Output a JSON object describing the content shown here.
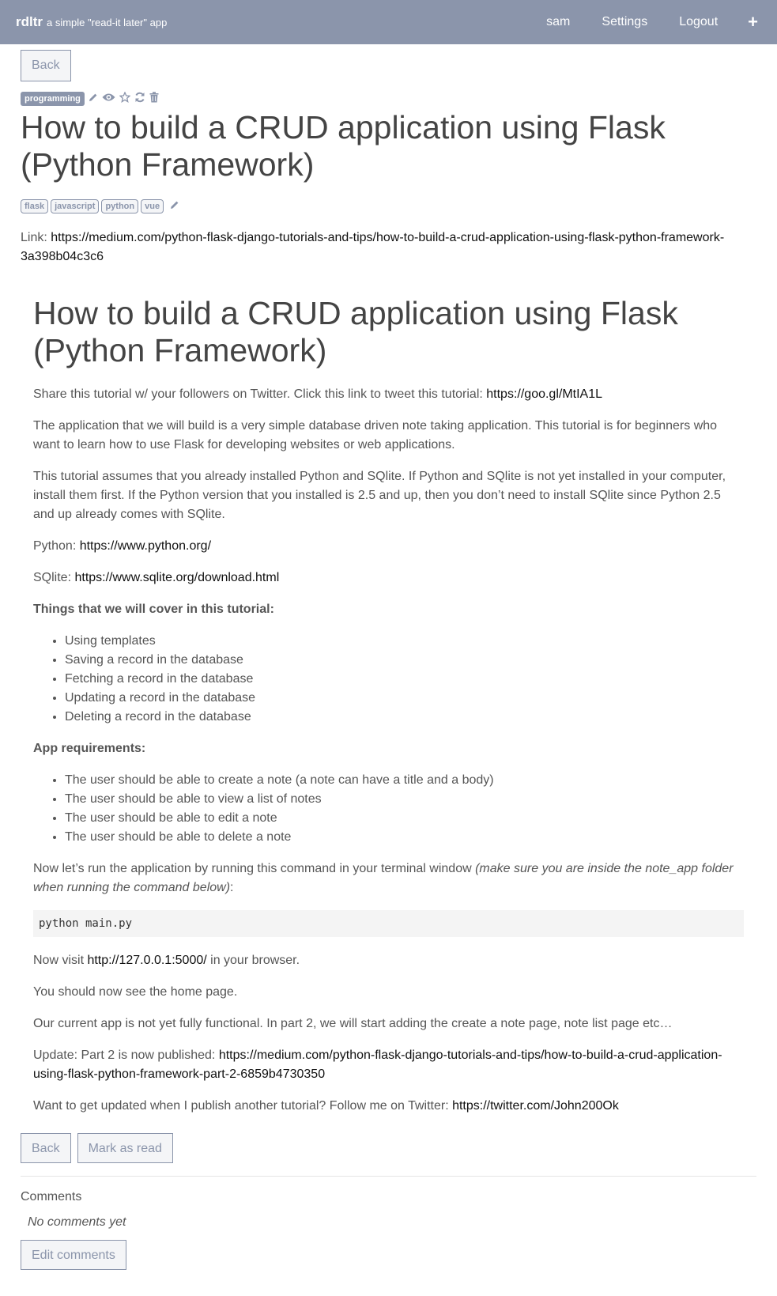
{
  "navbar": {
    "brand": "rdltr",
    "tagline": "a simple \"read-it later\" app",
    "user": "sam",
    "settings": "Settings",
    "logout": "Logout",
    "add": "+"
  },
  "article_meta": {
    "back_label": "Back",
    "category": "programming",
    "title": "How to build a CRUD application using Flask (Python Framework)",
    "tags": [
      "flask",
      "javascript",
      "python",
      "vue"
    ],
    "link_label": "Link:",
    "link_url": "https://medium.com/python-flask-django-tutorials-and-tips/how-to-build-a-crud-application-using-flask-python-framework-3a398b04c3c6"
  },
  "content": {
    "heading": "How to build a CRUD application using Flask (Python Framework)",
    "p1_text": "Share this tutorial w/ your followers on Twitter. Click this link to tweet this tutorial: ",
    "p1_link": "https://goo.gl/MtIA1L",
    "p2": "The application that we will build is a very simple database driven note taking application. This tutorial is for beginners who want to learn how to use Flask for developing websites or web applications.",
    "p3": "This tutorial assumes that you already installed Python and SQlite. If Python and SQlite is not yet installed in your computer, install them first. If the Python version that you installed is 2.5 and up, then you don’t need to install SQlite since Python 2.5 and up already comes with SQlite.",
    "python_label": "Python: ",
    "python_link": "https://www.python.org/",
    "sqlite_label": "SQlite: ",
    "sqlite_link": "https://www.sqlite.org/download.html",
    "cover_heading": "Things that we will cover in this tutorial:",
    "cover_items": [
      "Using templates",
      "Saving a record in the database",
      "Fetching a record in the database",
      "Updating a record in the database",
      "Deleting a record in the database"
    ],
    "req_heading": "App requirements:",
    "req_items": [
      "The user should be able to create a note (a note can have a title and a body)",
      "The user should be able to view a list of notes",
      "The user should be able to edit a note",
      "The user should be able to delete a note"
    ],
    "run_text": "Now let’s run the application by running this command in your terminal window ",
    "run_italic": "(make sure you are inside the note_app folder when running the command below)",
    "run_colon": ":",
    "code": "python main.py",
    "visit_prefix": "Now visit ",
    "visit_link": "http://127.0.0.1:5000/",
    "visit_suffix": " in your browser.",
    "home_page": "You should now see the home page.",
    "current_app": "Our current app is not yet fully functional. In part 2, we will start adding the create a note page, note list page etc…",
    "update_prefix": "Update: Part 2 is now published: ",
    "update_link": "https://medium.com/python-flask-django-tutorials-and-tips/how-to-build-a-crud-application-using-flask-python-framework-part-2-6859b4730350",
    "follow_prefix": "Want to get updated when I publish another tutorial? Follow me on Twitter: ",
    "follow_link": "https://twitter.com/John200Ok"
  },
  "actions": {
    "back_label": "Back",
    "mark_read_label": "Mark as read"
  },
  "comments": {
    "heading": "Comments",
    "empty": "No comments yet",
    "edit_label": "Edit comments"
  },
  "colors": {
    "accent": "#8b95ab"
  },
  "icons": [
    "pencil-icon",
    "eye-icon",
    "star-icon",
    "refresh-icon",
    "trash-icon",
    "plus-icon"
  ]
}
